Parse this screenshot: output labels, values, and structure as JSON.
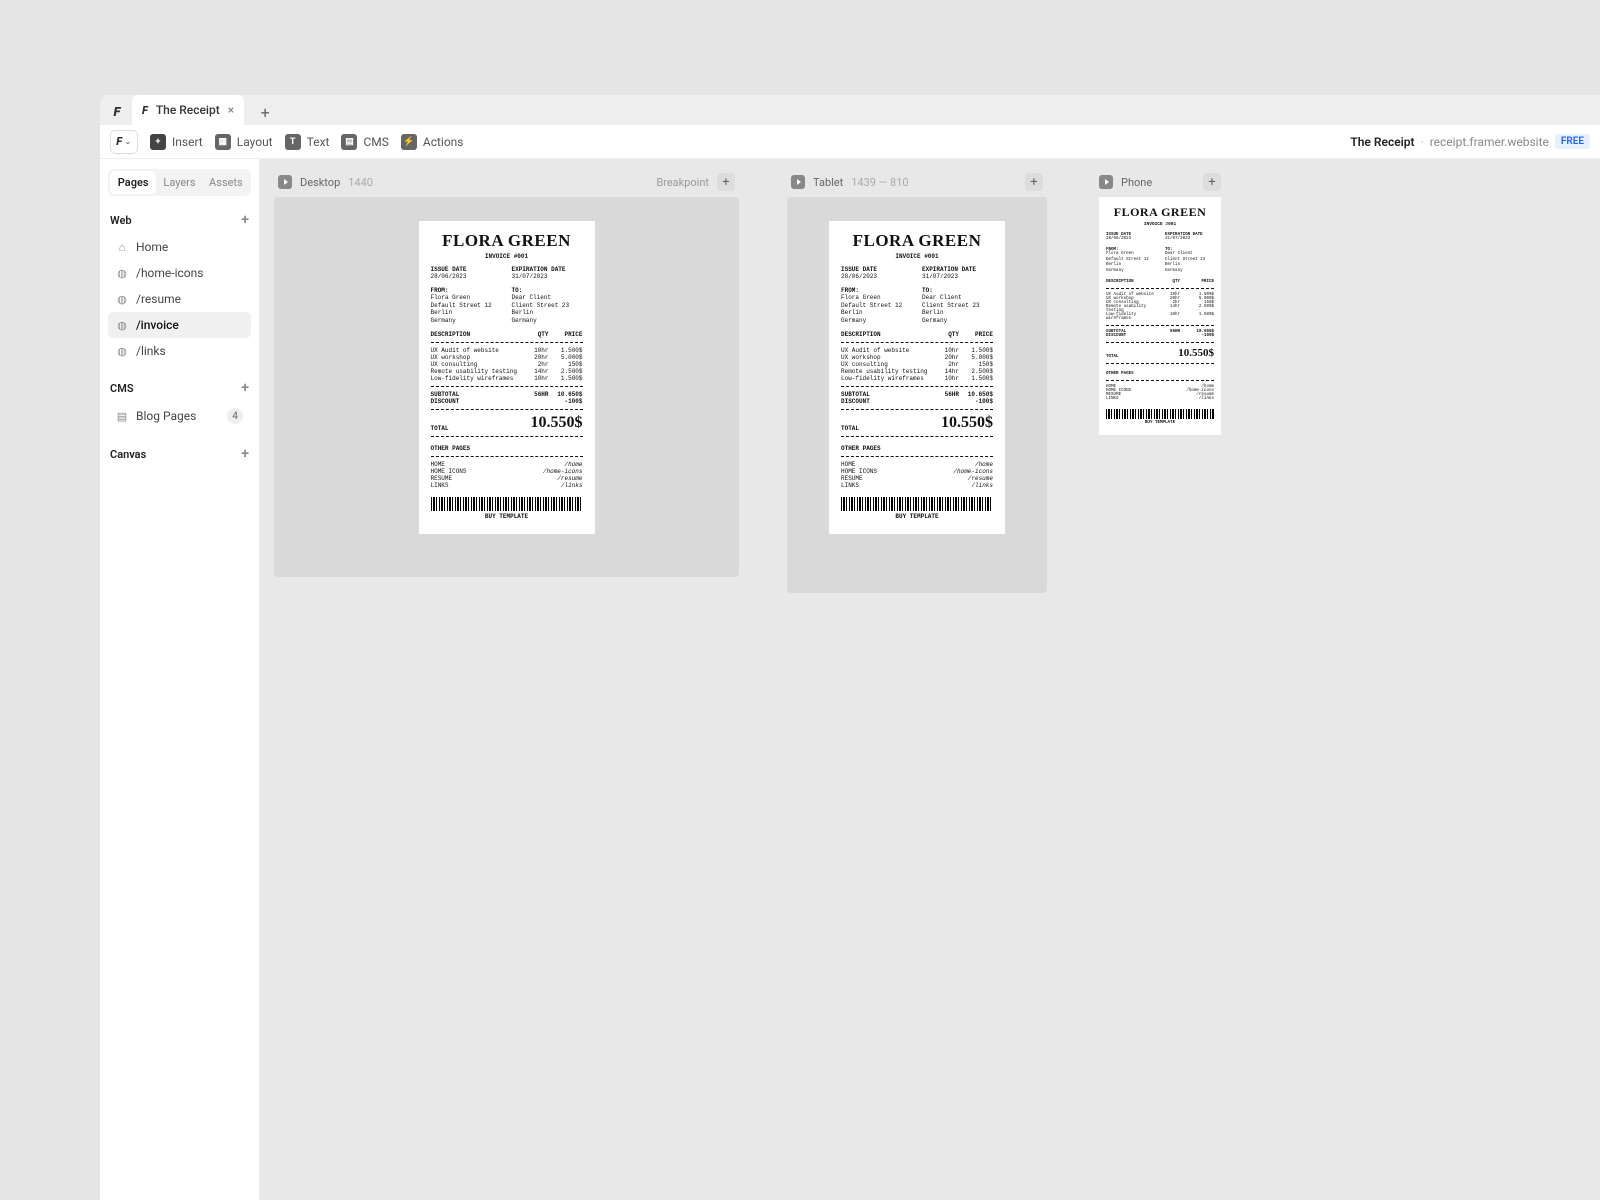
{
  "tab": {
    "title": "The Receipt"
  },
  "toolbar": {
    "insert": "Insert",
    "layout": "Layout",
    "text": "Text",
    "cms": "CMS",
    "actions": "Actions",
    "site_name": "The Receipt",
    "site_url": "receipt.framer.website",
    "badge": "FREE"
  },
  "sidebar": {
    "tabs": {
      "pages": "Pages",
      "layers": "Layers",
      "assets": "Assets"
    },
    "sections": {
      "web": "Web",
      "cms": "CMS",
      "canvas": "Canvas"
    },
    "web_items": [
      {
        "label": "Home"
      },
      {
        "label": "/home-icons"
      },
      {
        "label": "/resume"
      },
      {
        "label": "/invoice"
      },
      {
        "label": "/links"
      }
    ],
    "cms_items": [
      {
        "label": "Blog Pages",
        "count": "4"
      }
    ]
  },
  "viewports": {
    "desktop": {
      "label": "Desktop",
      "dim": "1440",
      "breakpoint": "Breakpoint"
    },
    "tablet": {
      "label": "Tablet",
      "dim": "1439 — 810"
    },
    "phone": {
      "label": "Phone"
    }
  },
  "receipt": {
    "brand": "FLORA GREEN",
    "invoice": "INVOICE #001",
    "issue_label": "ISSUE DATE",
    "issue_date": "28/06/2023",
    "exp_label": "EXPIRATION DATE",
    "exp_date": "31/07/2023",
    "from_label": "FROM:",
    "to_label": "TO:",
    "from": {
      "name": "Flora Green",
      "street": "Default Street 12",
      "city": "Berlin",
      "country": "Germany"
    },
    "to": {
      "name": "Dear Client",
      "street": "Client Street 23",
      "city": "Berlin",
      "country": "Germany"
    },
    "th": {
      "desc": "DESCRIPTION",
      "qty": "QTY",
      "price": "PRICE"
    },
    "items": [
      {
        "desc": "UX Audit of website",
        "qty": "10hr",
        "price": "1.500$"
      },
      {
        "desc": "UX workshop",
        "qty": "20hr",
        "price": "5.000$"
      },
      {
        "desc": "UX consulting",
        "qty": "2hr",
        "price": "150$"
      },
      {
        "desc": "Remote usability testing",
        "qty": "14hr",
        "price": "2.500$"
      },
      {
        "desc": "Low-fidelity wireframes",
        "qty": "10hr",
        "price": "1.500$"
      }
    ],
    "subtotal_label": "SUBTOTAL",
    "subtotal_qty": "56HR",
    "subtotal_price": "10.650$",
    "discount_label": "DISCOUNT",
    "discount_val": "-100$",
    "total_label": "TOTAL",
    "total_val": "10.550$",
    "other_pages_label": "OTHER PAGES",
    "pages": [
      {
        "name": "HOME",
        "path": "/home"
      },
      {
        "name": "HOME ICONS",
        "path": "/home-icons"
      },
      {
        "name": "RESUME",
        "path": "/resume"
      },
      {
        "name": "LINKS",
        "path": "/links"
      }
    ],
    "buy": "BUY TEMPLATE"
  }
}
